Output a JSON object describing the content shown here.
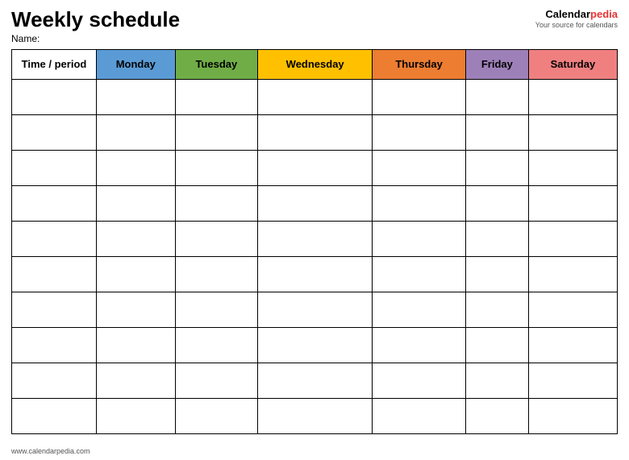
{
  "header": {
    "title": "Weekly schedule",
    "brand_calendar": "Calendar",
    "brand_pedia": "pedia",
    "brand_sub": "Your source for calendars"
  },
  "name_label": "Name:",
  "columns": [
    {
      "id": "time",
      "label": "Time / period",
      "class": "col-time"
    },
    {
      "id": "monday",
      "label": "Monday",
      "class": "col-monday"
    },
    {
      "id": "tuesday",
      "label": "Tuesday",
      "class": "col-tuesday"
    },
    {
      "id": "wednesday",
      "label": "Wednesday",
      "class": "col-wednesday"
    },
    {
      "id": "thursday",
      "label": "Thursday",
      "class": "col-thursday"
    },
    {
      "id": "friday",
      "label": "Friday",
      "class": "col-friday"
    },
    {
      "id": "saturday",
      "label": "Saturday",
      "class": "col-saturday"
    }
  ],
  "rows": 10,
  "footer": "www.calendarpedia.com"
}
